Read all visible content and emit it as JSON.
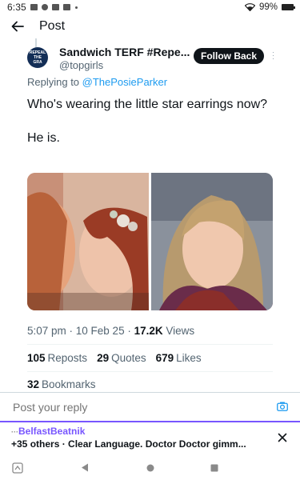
{
  "status_bar": {
    "time": "6:35",
    "battery": "99%"
  },
  "header": {
    "title": "Post"
  },
  "tweet": {
    "author_name": "Sandwich TERF #Repe...",
    "author_handle": "@topgirls",
    "avatar_text": [
      "REPEAL",
      "THE",
      "GRA"
    ],
    "follow_label": "Follow Back",
    "replying_prefix": "Replying to ",
    "replying_to": "@ThePosieParker",
    "text_line1": "Who's wearing the little star earrings now?",
    "text_line2": "He is.",
    "timestamp": "5:07 pm · 10 Feb 25 · ",
    "views_count": "17.2K",
    "views_label": " Views",
    "reposts_count": "105",
    "reposts_label": "Reposts",
    "quotes_count": "29",
    "quotes_label": "Quotes",
    "likes_count": "679",
    "likes_label": "Likes",
    "bookmarks_count": "32",
    "bookmarks_label": "Bookmarks"
  },
  "reply": {
    "placeholder": "Post your reply"
  },
  "notification": {
    "prefix": "···",
    "user": "BelfastBeatnik",
    "text": "+35 others · Clear Language. Doctor Doctor gimm..."
  },
  "colors": {
    "link_blue": "#1d9bf0",
    "notif_purple": "#7856ff",
    "text_primary": "#0f1419",
    "text_secondary": "#536471"
  }
}
